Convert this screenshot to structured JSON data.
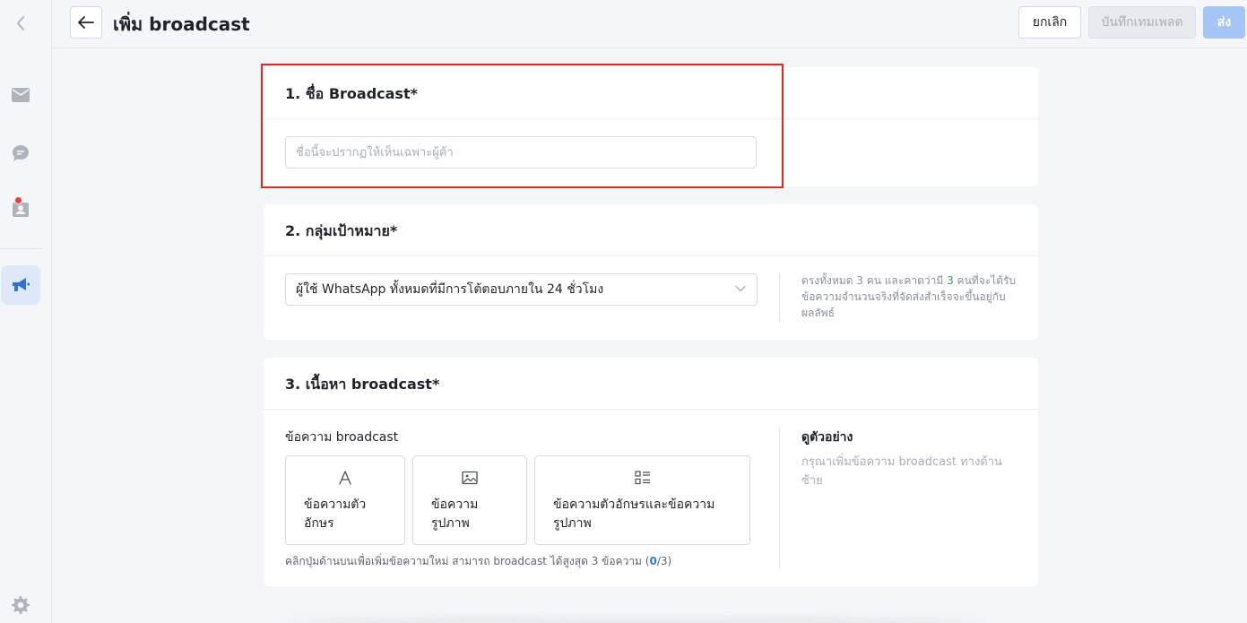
{
  "header": {
    "title": "เพิ่ม broadcast",
    "cancel_label": "ยกเลิก",
    "save_template_label": "บันทึกเทมเพลต",
    "send_label": "ส่ง"
  },
  "sidebar": {
    "items": [
      {
        "icon": "chevron-left-icon"
      },
      {
        "icon": "mail-icon"
      },
      {
        "icon": "chat-icon"
      },
      {
        "icon": "contacts-icon",
        "notification": true
      },
      {
        "icon": "megaphone-icon",
        "active": true
      },
      {
        "icon": "gear-icon"
      }
    ]
  },
  "section1": {
    "title": "1. ชื่อ Broadcast*",
    "input_value": "",
    "input_placeholder": "ชื่อนี้จะปรากฏให้เห็นเฉพาะผู้ค้า"
  },
  "section2": {
    "title": "2. กลุ่มเป้าหมาย*",
    "select_value": "ผู้ใช้ WhatsApp ทั้งหมดที่มีการโต้ตอบภายใน 24 ชั่วโมง",
    "note_prefix": "ตรงทั้งหมด 3 คน และคาดว่ามี ",
    "note_count": "3",
    "note_suffix": " คนที่จะได้รับข้อความจำนวนจริงที่จัดส่งสำเร็จจะขึ้นอยู่กับผลลัพธ์"
  },
  "section3": {
    "title": "3. เนื้อหา broadcast*",
    "message_label": "ข้อความ broadcast",
    "buttons": [
      {
        "icon": "text-icon",
        "label": "ข้อความตัวอักษร"
      },
      {
        "icon": "image-icon",
        "label": "ข้อความรูปภาพ"
      },
      {
        "icon": "text-image-icon",
        "label": "ข้อความตัวอักษรและข้อความรูปภาพ"
      }
    ],
    "hint_prefix": "คลิกปุ่มด้านบนเพื่อเพิ่มข้อความใหม่ สามารถ broadcast ได้สูงสุด 3 ข้อความ  (",
    "hint_count": "0",
    "hint_suffix": "/3)",
    "preview_title": "ดูตัวอย่าง",
    "preview_note": "กรุณาเพิ่มข้อความ broadcast ทางด้านซ้าย"
  },
  "colors": {
    "accent": "#2f7be8",
    "send_disabled": "#a6c5f7",
    "highlight": "#e8261b",
    "success_count": "#3aa04a"
  }
}
